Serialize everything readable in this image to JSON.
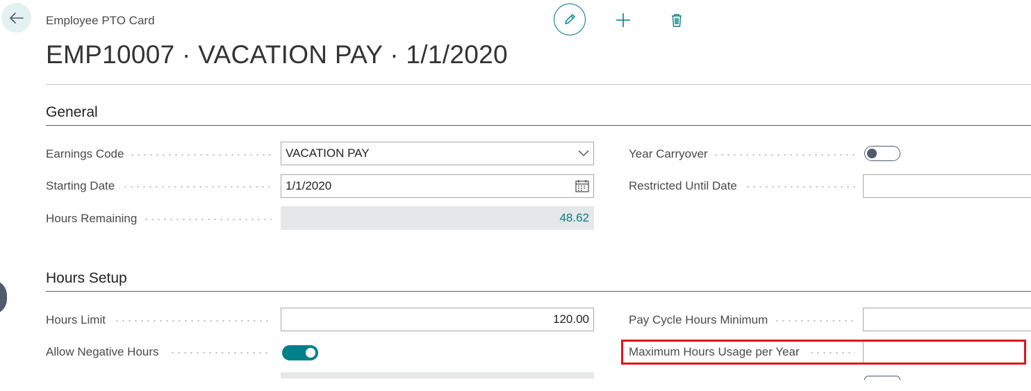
{
  "header": {
    "caption": "Employee PTO Card",
    "title": "EMP10007 · VACATION PAY · 1/1/2020"
  },
  "general": {
    "section_title": "General",
    "earnings_code": {
      "label": "Earnings Code",
      "value": "VACATION PAY"
    },
    "starting_date": {
      "label": "Starting Date",
      "value": "1/1/2020"
    },
    "hours_remaining": {
      "label": "Hours Remaining",
      "value": "48.62"
    },
    "year_carryover": {
      "label": "Year Carryover",
      "toggle_on": false
    },
    "restricted_until_date": {
      "label": "Restricted Until Date",
      "value": ""
    }
  },
  "hours_setup": {
    "section_title": "Hours Setup",
    "hours_limit": {
      "label": "Hours Limit",
      "value": "120.00"
    },
    "allow_negative_hours": {
      "label": "Allow Negative Hours",
      "toggle_on": true
    },
    "pay_cycle_hours_minimum": {
      "label": "Pay Cycle Hours Minimum",
      "value": ""
    },
    "maximum_hours_usage_per_year": {
      "label": "Maximum Hours Usage per Year",
      "value": ""
    }
  },
  "colors": {
    "accent": "#00818a",
    "highlight": "#e0141e",
    "toggle_off": "#505c6d",
    "readonly_bg": "#e6e7e8"
  }
}
